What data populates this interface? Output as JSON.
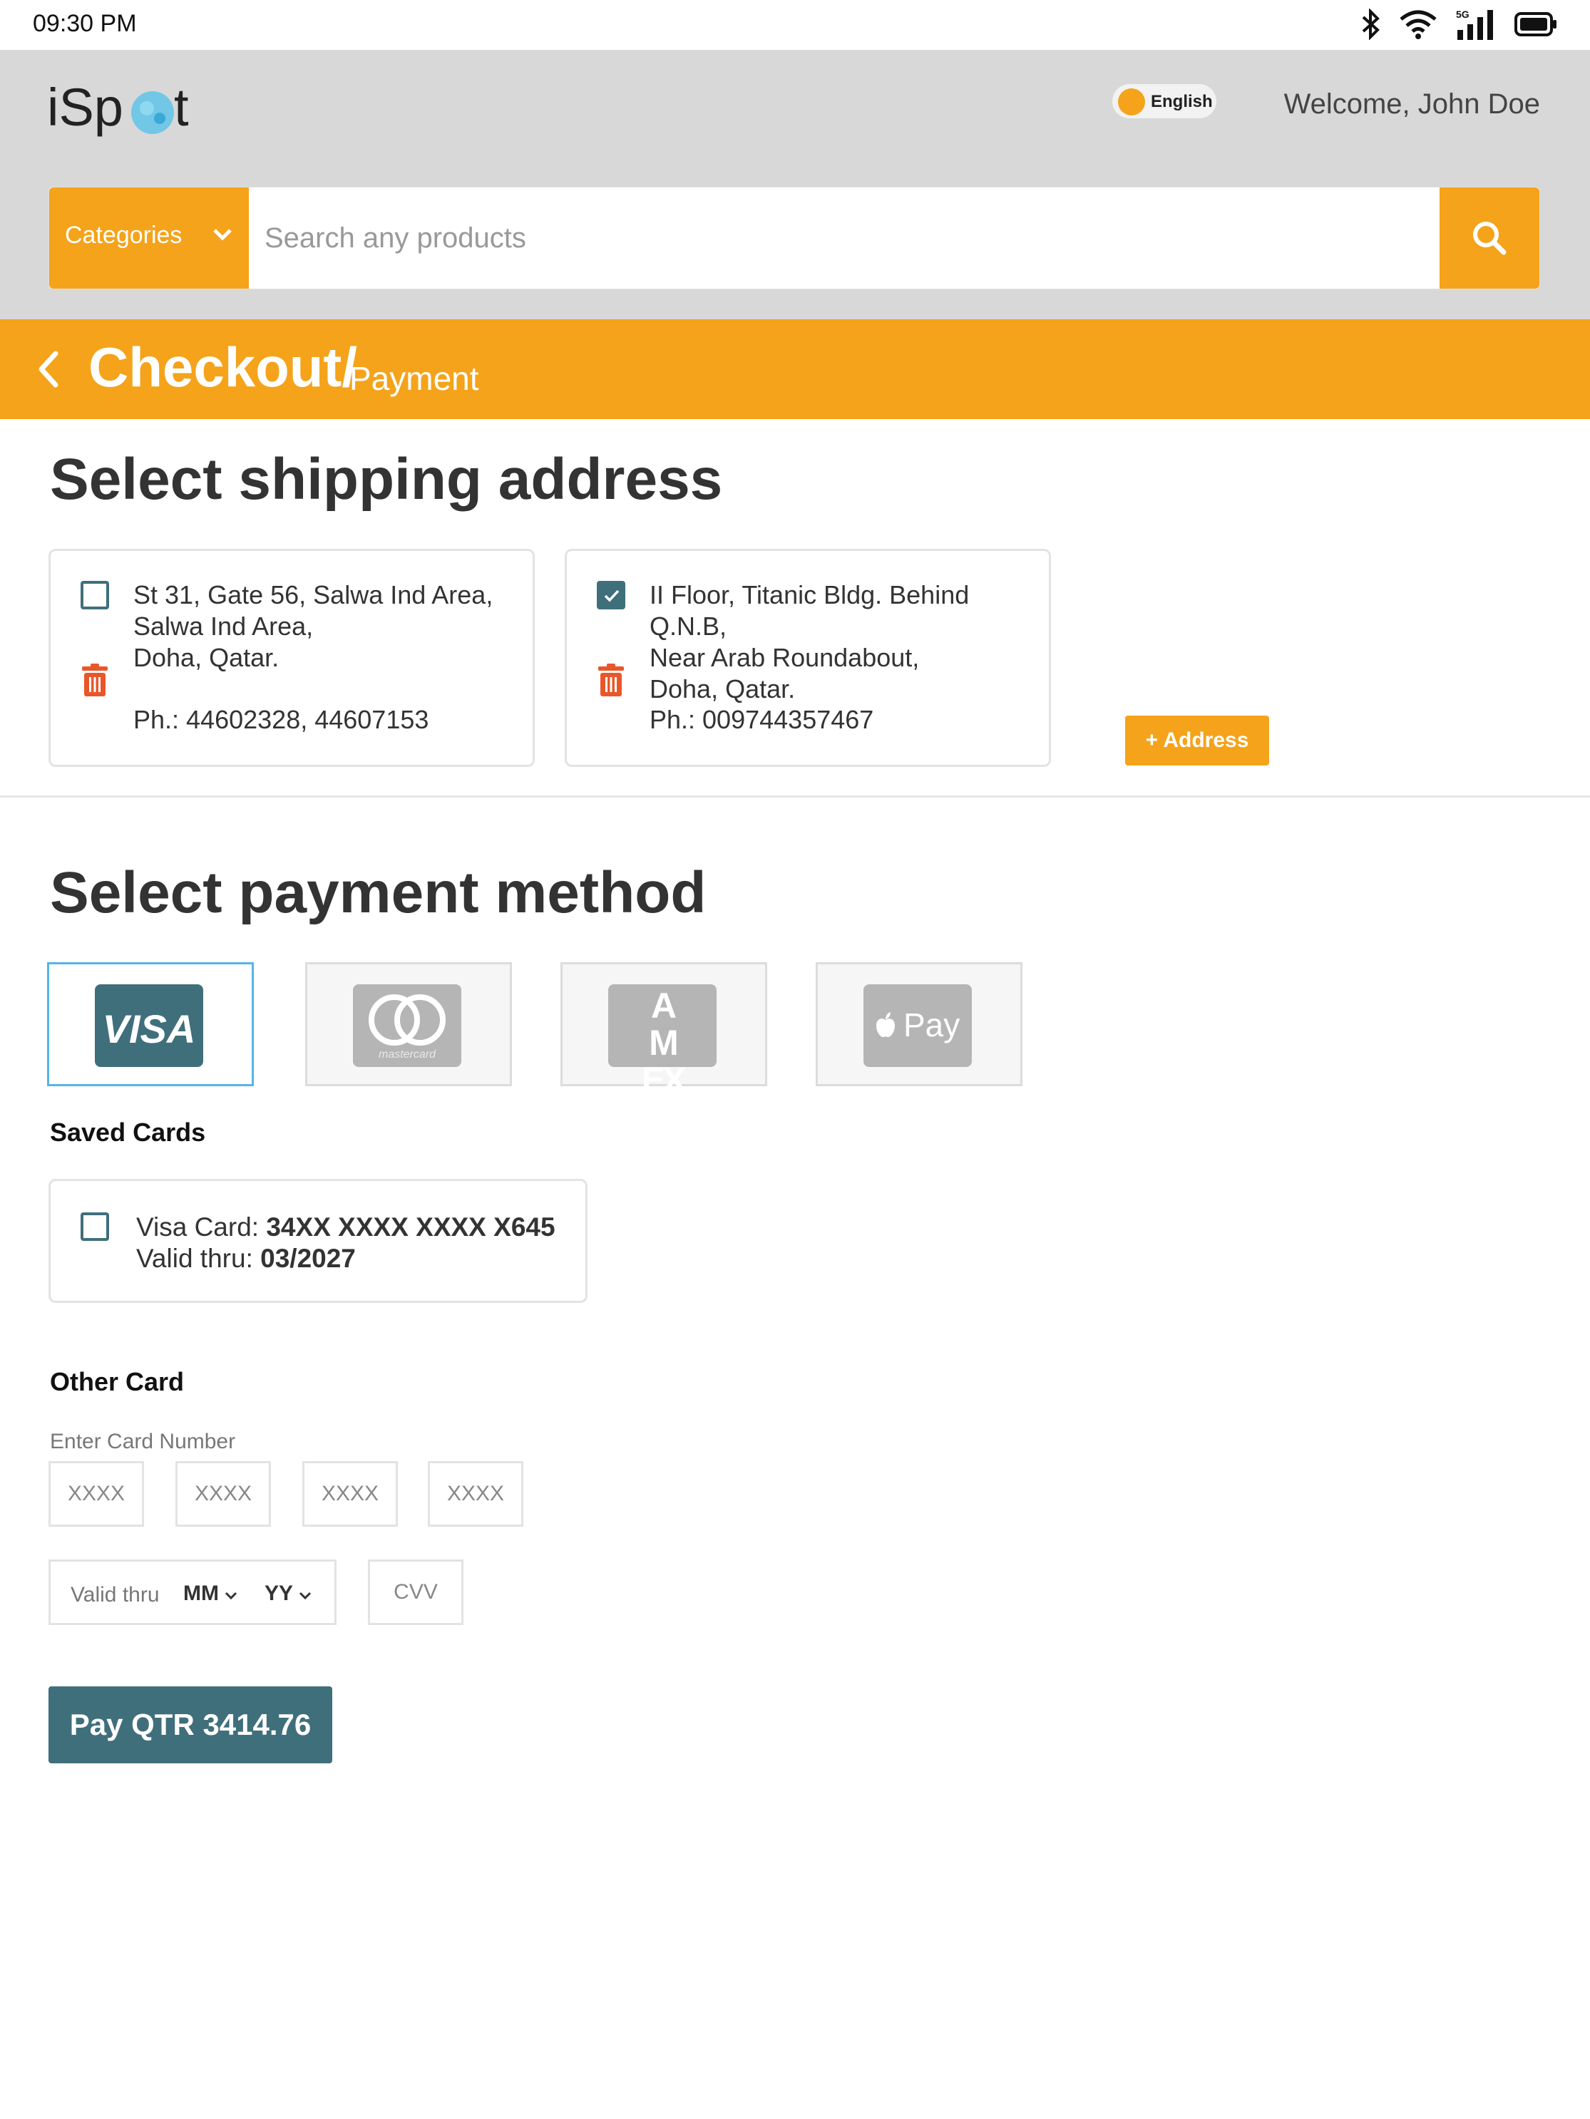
{
  "status_bar": {
    "time": "09:30 PM",
    "network": "5G"
  },
  "header": {
    "logo_text": "iSpot",
    "language": "English",
    "welcome": "Welcome, John Doe",
    "categories_label": "Categories",
    "search_placeholder": "Search any products"
  },
  "checkout": {
    "title": "Checkout/",
    "subtitle": "Payment"
  },
  "shipping": {
    "title": "Select shipping address",
    "addresses": [
      {
        "line1": "St 31, Gate 56, Salwa Ind Area,",
        "line2": "Salwa Ind Area,",
        "line3": "Doha, Qatar.",
        "phone": "Ph.: 44602328, 44607153",
        "checked": false
      },
      {
        "line1": "II Floor, Titanic Bldg. Behind Q.N.B,",
        "line2": "Near Arab Roundabout,",
        "line3": "Doha, Qatar.",
        "phone": "Ph.: 009744357467",
        "checked": true
      }
    ],
    "add_button": "+ Address"
  },
  "payment": {
    "title": "Select payment method",
    "methods": [
      {
        "name": "VISA",
        "selected": true
      },
      {
        "name": "mastercard",
        "selected": false
      },
      {
        "name": "AM EX",
        "selected": false
      },
      {
        "name": "Pay",
        "selected": false
      }
    ],
    "saved_cards_title": "Saved Cards",
    "saved_card": {
      "type_label": "Visa Card:",
      "number": "34XX XXXX XXXX X645",
      "valid_label": "Valid thru:",
      "valid": "03/2027"
    },
    "other_card_title": "Other Card",
    "enter_card_label": "Enter Card Number",
    "card_placeholder": "XXXX",
    "valid_thru_label": "Valid thru",
    "month": "MM",
    "year": "YY",
    "cvv_placeholder": "CVV",
    "pay_button": "Pay QTR 3414.76"
  },
  "colors": {
    "accent": "#f5a31a",
    "primary": "#406f7c",
    "delete": "#e8572a"
  }
}
